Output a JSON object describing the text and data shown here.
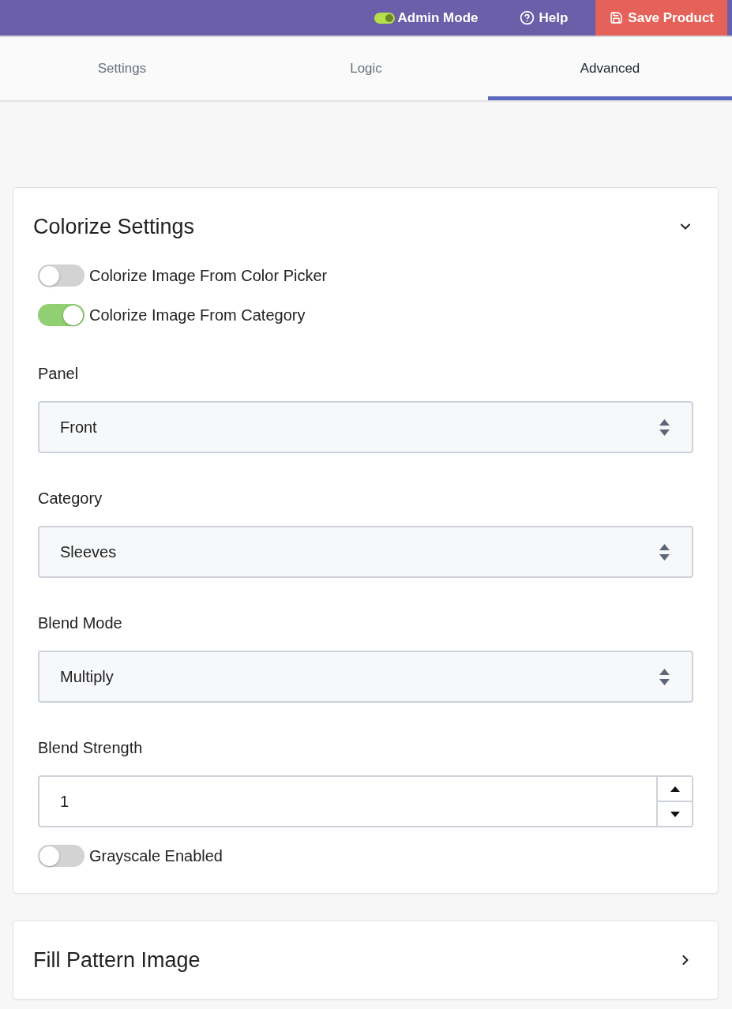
{
  "top_bar": {
    "admin_mode": {
      "label": "Admin Mode",
      "on": true
    },
    "help": {
      "label": "Help"
    },
    "save_button": {
      "label": "Save Product"
    }
  },
  "tabs": [
    {
      "label": "Settings",
      "selected": false
    },
    {
      "label": "Logic",
      "selected": false
    },
    {
      "label": "Advanced",
      "selected": true
    }
  ],
  "sections": [
    {
      "title": "Colorize Settings",
      "expanded": true,
      "fields": [
        {
          "kind": "toggle",
          "label": "Colorize Image From Color Picker",
          "on": false
        },
        {
          "kind": "toggle",
          "label": "Colorize Image From Category",
          "on": true
        },
        {
          "kind": "select",
          "label": "Panel",
          "value": "Front"
        },
        {
          "kind": "select",
          "label": "Category",
          "value": "Sleeves"
        },
        {
          "kind": "select",
          "label": "Blend Mode",
          "value": "Multiply"
        },
        {
          "kind": "number",
          "label": "Blend Strength",
          "value": "1"
        },
        {
          "kind": "toggle",
          "label": "Grayscale Enabled",
          "on": false
        }
      ]
    },
    {
      "title": "Fill Pattern Image",
      "expanded": false
    }
  ]
}
